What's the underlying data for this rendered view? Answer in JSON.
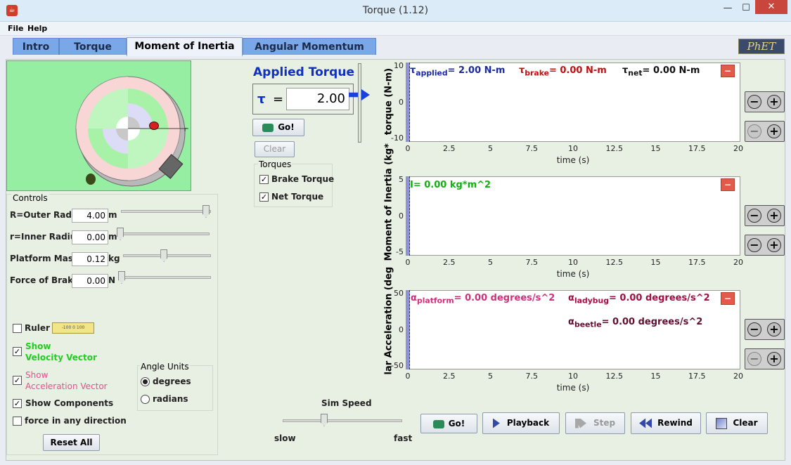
{
  "window": {
    "title": "Torque (1.12)",
    "min": "—",
    "max": "☐",
    "close": "✕"
  },
  "menu": [
    "File",
    "Help"
  ],
  "tabs": [
    "Intro",
    "Torque",
    "Moment of Inertia",
    "Angular Momentum"
  ],
  "logo": "PhET",
  "applied": {
    "title": "Applied Torque",
    "symbol": "τ",
    "eq": "=",
    "value": "2.00",
    "go": "Go!",
    "clear": "Clear",
    "torques_title": "Torques",
    "brake": "Brake Torque",
    "net": "Net Torque"
  },
  "controls": {
    "title": "Controls",
    "rows": [
      {
        "label": "R=Outer Radius",
        "value": "4.00",
        "unit": "m",
        "frac": 1.0
      },
      {
        "label": "r=Inner Radius",
        "value": "0.00",
        "unit": "m",
        "frac": 0.0
      },
      {
        "label": "Platform Mass",
        "value": "0.12",
        "unit": "kg",
        "frac": 0.48
      },
      {
        "label": "Force of Brake",
        "value": "0.00",
        "unit": "N",
        "frac": 0.0
      }
    ],
    "ruler": "Ruler",
    "ruler_ticks": "-100 0 100",
    "show1": "Show",
    "velocity": "Velocity Vector",
    "show2": "Show",
    "accel": "Acceleration Vector",
    "components": "Show Components",
    "anydir": "force in any direction",
    "reset": "Reset All",
    "angle_title": "Angle Units",
    "degrees": "degrees",
    "radians": "radians"
  },
  "sim": {
    "title": "Sim Speed",
    "slow": "slow",
    "fast": "fast",
    "speed": 0.4
  },
  "bottom": {
    "go": "Go!",
    "playback": "Playback",
    "step": "Step",
    "rewind": "Rewind",
    "clear": "Clear"
  },
  "chart1": {
    "ylabel": "torque (N-m)",
    "yticks": [
      "10",
      "0",
      "-10"
    ],
    "l1": "τ",
    "l1s": "applied",
    "l1v": "= 2.00 N-m",
    "l2": "τ",
    "l2s": "brake",
    "l2v": "= 0.00 N-m",
    "l3": "τ",
    "l3s": "net",
    "l3v": "= 0.00 N-m",
    "colors": {
      "applied": "#1a2aa0",
      "brake": "#c01010",
      "net": "#111111"
    }
  },
  "chart2": {
    "ylabel": "Moment of Inertia (kg*",
    "yticks": [
      "5",
      "0",
      "-5"
    ],
    "l1": "I= 0.00 kg*m^2",
    "color": "#10b010"
  },
  "chart3": {
    "ylabel": "lar Acceleration (deg",
    "yticks": [
      "50",
      "0",
      "-50"
    ],
    "l1": "α",
    "l1s": "platform",
    "l1v": "= 0.00 degrees/s^2",
    "l2": "α",
    "l2s": "ladybug",
    "l2v": "= 0.00 degrees/s^2",
    "l3": "α",
    "l3s": "beetle",
    "l3v": "= 0.00 degrees/s^2",
    "colors": {
      "platform": "#d0307a",
      "ladybug": "#a01040",
      "beetle": "#601030"
    }
  },
  "xaxis": {
    "label": "time (s)",
    "ticks": [
      "0",
      "2.5",
      "5",
      "7.5",
      "10",
      "12.5",
      "15",
      "17.5",
      "20"
    ]
  },
  "chart_data": [
    {
      "type": "line",
      "title": "",
      "ylabel": "torque (N-m)",
      "xlabel": "time (s)",
      "xlim": [
        0,
        20
      ],
      "ylim": [
        -10,
        10
      ],
      "series": []
    },
    {
      "type": "line",
      "title": "",
      "ylabel": "Moment of Inertia (kg*",
      "xlabel": "time (s)",
      "xlim": [
        0,
        20
      ],
      "ylim": [
        -5,
        5
      ],
      "series": []
    },
    {
      "type": "line",
      "title": "",
      "ylabel": "lar Acceleration (deg",
      "xlabel": "time (s)",
      "xlim": [
        0,
        20
      ],
      "ylim": [
        -50,
        50
      ],
      "series": []
    }
  ]
}
